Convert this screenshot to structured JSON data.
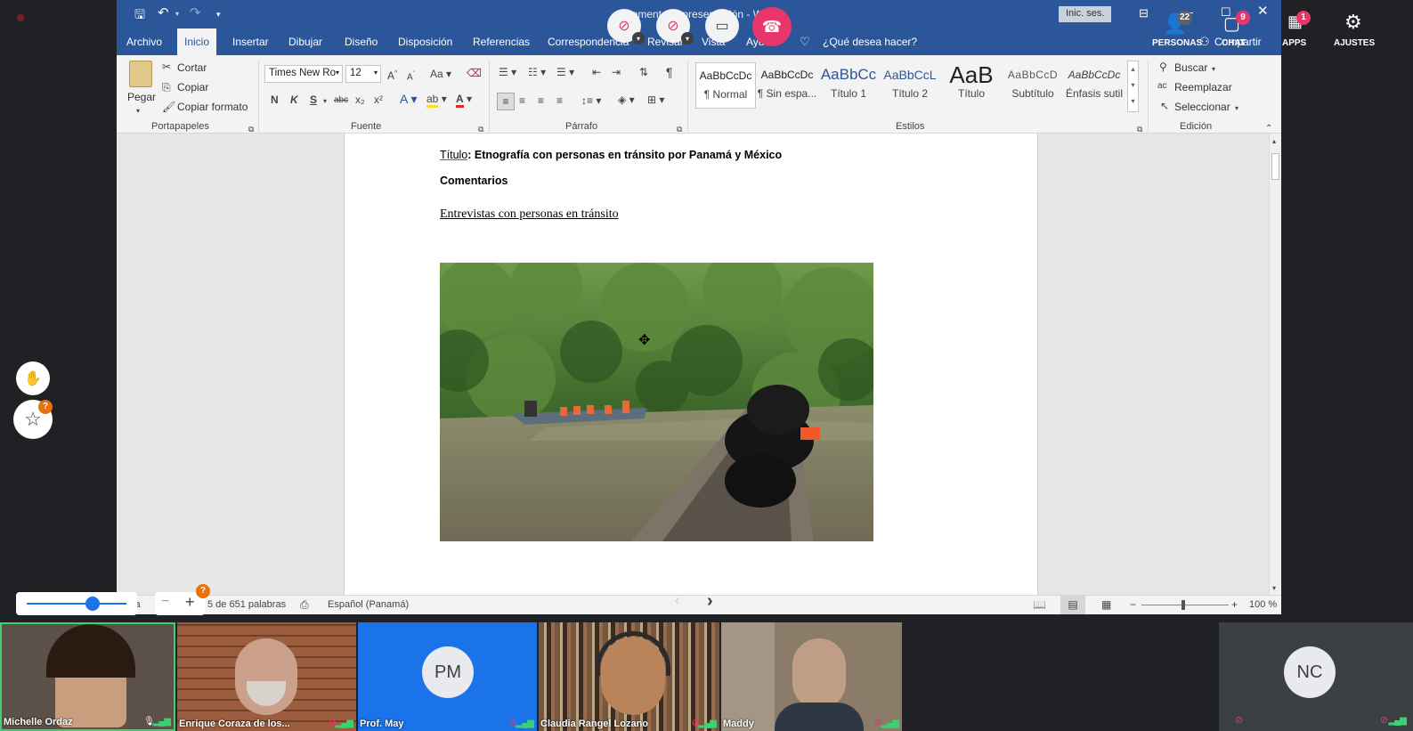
{
  "word": {
    "title": "Comentario presentación - Word",
    "signin": "Inic. ses.",
    "tabs": [
      "Archivo",
      "Inicio",
      "Insertar",
      "Dibujar",
      "Diseño",
      "Disposición",
      "Referencias",
      "Correspondencia",
      "Revisar",
      "Vista",
      "Ayuda"
    ],
    "tell_me": "¿Qué desea hacer?",
    "share": "Compartir",
    "clipboard": {
      "paste": "Pegar",
      "cut": "Cortar",
      "copy": "Copiar",
      "format_painter": "Copiar formato",
      "label": "Portapapeles"
    },
    "font": {
      "name": "Times New Ro",
      "size": "12",
      "bold": "N",
      "italic": "K",
      "underline": "S",
      "strike": "abc",
      "sub": "x₂",
      "sup": "x²",
      "label": "Fuente"
    },
    "paragraph": {
      "label": "Párrafo"
    },
    "styles": {
      "label": "Estilos",
      "items": [
        {
          "preview": "AaBbCcDc",
          "name": "¶ Normal"
        },
        {
          "preview": "AaBbCcDc",
          "name": "¶ Sin espa..."
        },
        {
          "preview": "AaBbCc",
          "name": "Título 1"
        },
        {
          "preview": "AaBbCcL",
          "name": "Título 2"
        },
        {
          "preview": "AaB",
          "name": "Título"
        },
        {
          "preview": "AaBbCcD",
          "name": "Subtítulo"
        },
        {
          "preview": "AaBbCcDc",
          "name": "Énfasis sutil"
        }
      ]
    },
    "editing": {
      "find": "Buscar",
      "replace": "Reemplazar",
      "select": "Seleccionar",
      "label": "Edición"
    },
    "document": {
      "title_label": "Título",
      "title_text": ": Etnografía con personas en tránsito por Panamá y México",
      "comments": "Comentarios",
      "subtitle": "Entrevistas con personas en tránsito"
    },
    "status": {
      "page": "ina",
      "words": "5 de 651 palabras",
      "language": "Español (Panamá)",
      "zoom": "100 %"
    }
  },
  "meeting": {
    "people_label": "PERSONAS",
    "people_count": "22",
    "chat_label": "CHAT",
    "chat_count": "9",
    "apps_label": "APPS",
    "apps_count": "1",
    "settings_label": "AJUSTES",
    "reactions_badge": "?",
    "zoom_badge": "?",
    "participants": [
      {
        "name": "Michelle Ordaz",
        "initials": ""
      },
      {
        "name": "Enrique Coraza de los...",
        "initials": ""
      },
      {
        "name": "Prof. May",
        "initials": "PM"
      },
      {
        "name": "Claudia Rangel Lozano",
        "initials": ""
      },
      {
        "name": "Maddy",
        "initials": ""
      },
      {
        "name": "",
        "initials": "NC"
      }
    ]
  }
}
